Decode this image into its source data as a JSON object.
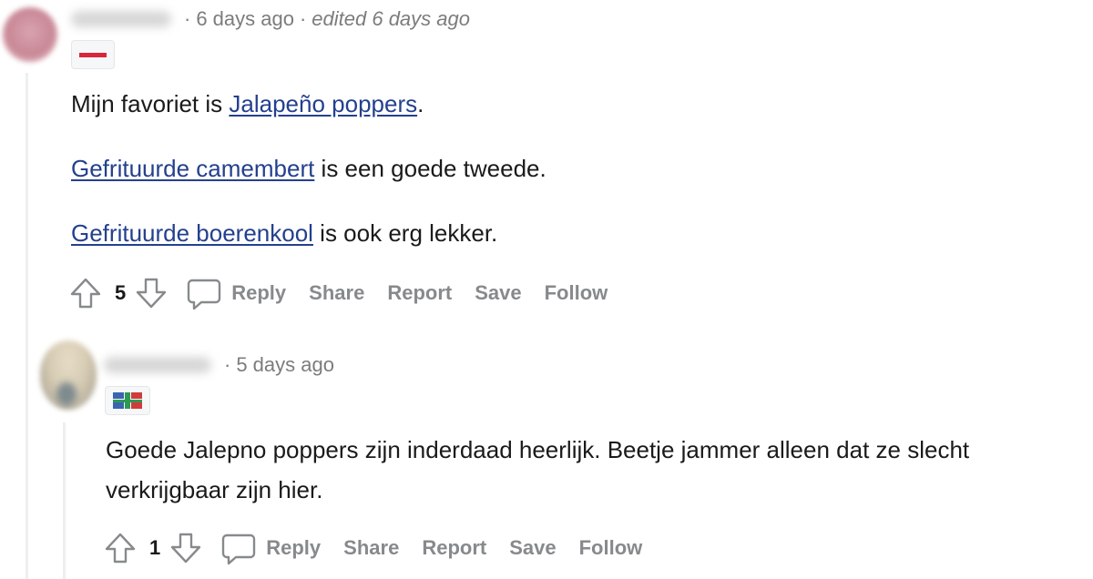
{
  "comments": [
    {
      "timestamp": "6 days ago",
      "edited": "edited 6 days ago",
      "paragraphs": [
        {
          "link": "Jalapeño poppers",
          "prefix": "Mijn favoriet is ",
          "suffix": "."
        },
        {
          "link": "Gefrituurde camembert",
          "prefix": "",
          "suffix": " is een goede tweede."
        },
        {
          "link": "Gefrituurde boerenkool",
          "prefix": "",
          "suffix": " is ook erg lekker."
        }
      ],
      "score": "5",
      "actions": {
        "reply": "Reply",
        "share": "Share",
        "report": "Report",
        "save": "Save",
        "follow": "Follow"
      }
    },
    {
      "timestamp": "5 days ago",
      "body": "Goede Jalepno poppers zijn inderdaad heerlijk. Beetje jammer alleen dat ze slecht verkrijgbaar zijn hier.",
      "score": "1",
      "actions": {
        "reply": "Reply",
        "share": "Share",
        "report": "Report",
        "save": "Save",
        "follow": "Follow"
      }
    }
  ],
  "separator": "·",
  "colors": {
    "link": "#24408e",
    "meta": "#7c7c7c",
    "action": "#878a8c",
    "thread_line": "#edeff1"
  },
  "icons": {
    "upvote": "arrow-up-outline-icon",
    "downvote": "arrow-down-outline-icon",
    "reply": "speech-bubble-icon"
  }
}
